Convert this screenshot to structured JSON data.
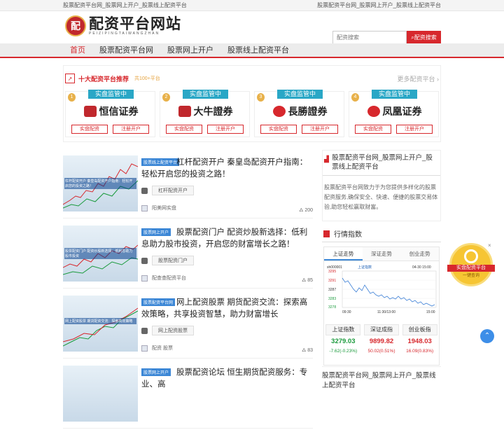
{
  "topbar": {
    "left": "股票配资平台网_股票网上开户_股票线上配资平台",
    "right": "股票配资平台网_股票网上开户_股票线上配资平台"
  },
  "logo": {
    "title": "配资平台网站",
    "subtitle": "PEIZIPINGTAIWANGZHAN",
    "mark": "配"
  },
  "search": {
    "placeholder": "配资搜索",
    "button": "配资搜索"
  },
  "nav": [
    "首页",
    "股票配资平台网",
    "股票网上开户",
    "股票线上配资平台"
  ],
  "recommend": {
    "title": "十大配资平台推荐",
    "count": "共100+平台",
    "more": "更多配资平台",
    "cards": [
      {
        "tag": "实盘监管中",
        "rank": "1",
        "name": "恒信证券",
        "icon_color": "#c0282d",
        "btn1": "实盘配资",
        "btn2": "注册开户"
      },
      {
        "tag": "实盘监管中",
        "rank": "2",
        "name": "大牛證券",
        "icon_color": "#c0282d",
        "btn1": "实盘配资",
        "btn2": "注册开户"
      },
      {
        "tag": "实盘监管中",
        "rank": "3",
        "name": "長勝證券",
        "icon_color": "#d7282d",
        "btn1": "实盘配资",
        "btn2": "注册开户"
      },
      {
        "tag": "实盘监管中",
        "rank": "4",
        "name": "凤凰证券",
        "icon_color": "#d7282d",
        "btn1": "实盘配资",
        "btn2": "注册开户"
      }
    ]
  },
  "articles": [
    {
      "category": "股票线上配资平台",
      "title": "杠杆配资开户 秦皇岛配资开户指南：轻松开启您的投资之路！",
      "tag": "杠杆配资开户",
      "author": "阳美网实盘",
      "views": "200",
      "thumb_caption": "杠杆配资开户 秦皇岛配资开户指南：轻松开启您的投资之路！"
    },
    {
      "category": "股票网上开户",
      "title": "股票配资门户 配资炒股新选择：低利息助力股市投资，开启您的财富增长之路！",
      "tag": "股票配资门户",
      "author": "配查查配资平台",
      "views": "85",
      "thumb_caption": "股票配资门户 配资炒股新选择：低利息助力股市投资"
    },
    {
      "category": "股票配资平台网",
      "title": "网上配资股票 期货配资交流：探索高效策略，共享投资智慧，助力财富增长",
      "tag": "网上配资股票",
      "author": "配资 股票",
      "views": "83",
      "thumb_caption": "网上配资股票 期货配资交流：探索高效策略"
    },
    {
      "category": "股票网上开户",
      "title": "股票配资论坛 恒生期货配资服务：专业、高",
      "tag": "",
      "author": "",
      "views": "",
      "thumb_caption": ""
    }
  ],
  "sidebar": {
    "site_title": "股票配资平台网_股票网上开户_股票线上配资平台",
    "description": "股票配资平台网致力于为您提供多样化的股票配资服务,确保安全、快速、便捷的股票交易体验,助您轻松赢取财富。",
    "index_title": "行情指数",
    "tabs": [
      "上证走势",
      "深证走势",
      "创业走势"
    ],
    "chart": {
      "code": "sh000001",
      "name": "上证指数",
      "time": "04-30 15:00",
      "y_ticks": [
        "3295",
        "3291",
        "3287",
        "3283",
        "3278"
      ],
      "x_ticks": [
        "09:30",
        "11:30/13:00",
        "15:00"
      ]
    },
    "quotes": [
      {
        "name": "上证指数",
        "value": "3279.03",
        "change": "-7.62(-0.23%)",
        "dir": "dn"
      },
      {
        "name": "深证成指",
        "value": "9899.82",
        "change": "50.02(0.51%)",
        "dir": "up"
      },
      {
        "name": "创业板指",
        "value": "1948.03",
        "change": "16.09(0.83%)",
        "dir": "up"
      }
    ],
    "next_title": "股票配资平台网_股票网上开户_股票线上配资平台"
  },
  "float": {
    "title": "实盘配资平台",
    "sub": "一键查询",
    "close": "×"
  },
  "backtop": "⌃"
}
